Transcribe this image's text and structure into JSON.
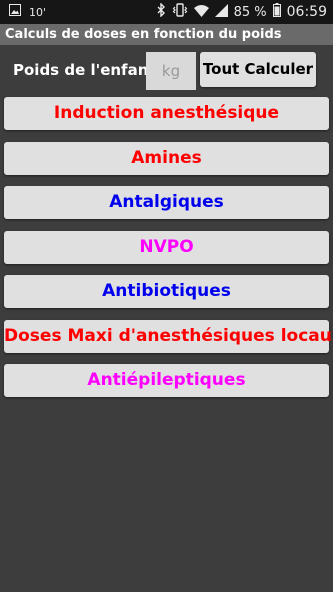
{
  "status_bar": {
    "temperature": "10'",
    "battery_percent": "85 %",
    "time": "06:59",
    "icons": [
      "image-icon",
      "bluetooth-icon",
      "vibrate-icon",
      "wifi-icon",
      "signal-icon",
      "battery-icon"
    ]
  },
  "app": {
    "title": "Calculs de doses en fonction du poids"
  },
  "weight": {
    "label": "Poids de l'enfant",
    "placeholder": "kg",
    "calc_all_label": "Tout Calculer"
  },
  "categories": [
    {
      "label": "Induction anesthésique",
      "color": "#ff0000"
    },
    {
      "label": "Amines",
      "color": "#ff0000"
    },
    {
      "label": "Antalgiques",
      "color": "#0000ee"
    },
    {
      "label": "NVPO",
      "color": "#ff00ff"
    },
    {
      "label": "Antibiotiques",
      "color": "#0000ee"
    },
    {
      "label": "Doses Maxi d'anesthésiques locaux",
      "color": "#ff0000"
    },
    {
      "label": "Antiépileptiques",
      "color": "#ff00ff"
    }
  ]
}
